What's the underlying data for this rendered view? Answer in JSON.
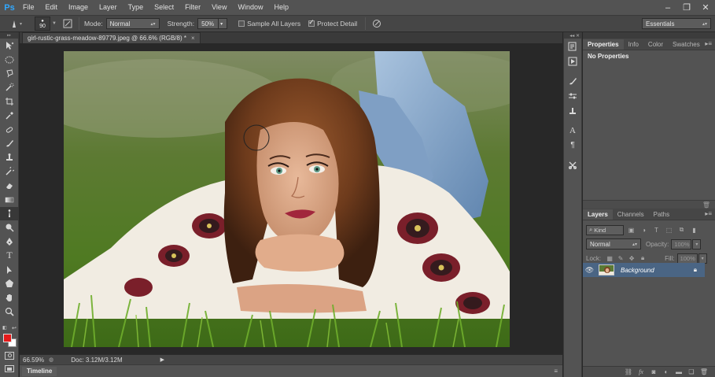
{
  "app": {
    "logo": "Ps"
  },
  "menu": [
    "File",
    "Edit",
    "Image",
    "Layer",
    "Type",
    "Select",
    "Filter",
    "View",
    "Window",
    "Help"
  ],
  "window_controls": {
    "minimize": "‒",
    "restore": "❐",
    "close": "✕"
  },
  "options": {
    "brush_size": "90",
    "mode_label": "Mode:",
    "mode_value": "Normal",
    "strength_label": "Strength:",
    "strength_value": "50%",
    "sample_all_layers": "Sample All Layers",
    "sample_all_layers_checked": false,
    "protect_detail": "Protect Detail",
    "protect_detail_checked": true,
    "workspace": "Essentials"
  },
  "document": {
    "tab_title": "girl-rustic-grass-meadow-89779.jpeg @ 66.6% (RGB/8) *",
    "tab_close": "×"
  },
  "status": {
    "zoom": "66.59%",
    "doc_info": "Doc: 3.12M/3.12M"
  },
  "timeline": {
    "label": "Timeline"
  },
  "colors": {
    "foreground": "#e41a1a",
    "background": "#ffffff",
    "selection": "#4a6584"
  },
  "properties_panel": {
    "tabs": [
      "Properties",
      "Info",
      "Color",
      "Swatches"
    ],
    "content": "No Properties"
  },
  "layers_panel": {
    "tabs": [
      "Layers",
      "Channels",
      "Paths"
    ],
    "filter_kind": "Kind",
    "blend_mode": "Normal",
    "opacity_label": "Opacity:",
    "opacity_value": "100%",
    "lock_label": "Lock:",
    "fill_label": "Fill:",
    "fill_value": "100%",
    "layers": [
      {
        "name": "Background",
        "visible": true,
        "locked": true
      }
    ]
  }
}
